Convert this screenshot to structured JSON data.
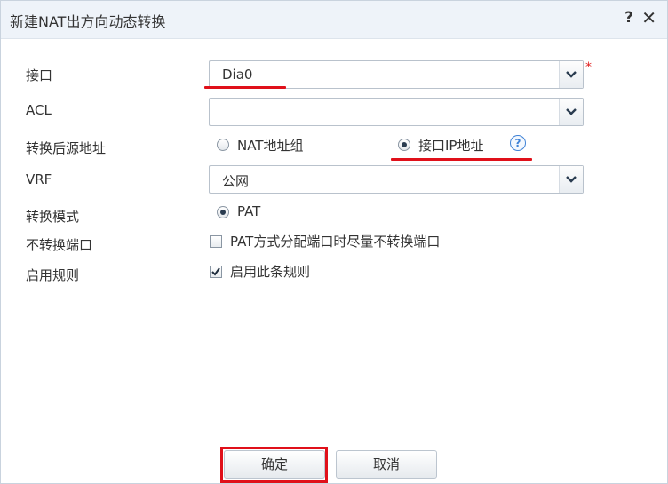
{
  "dialog": {
    "title": "新建NAT出方向动态转换",
    "help_label": "?",
    "close_label": "✕"
  },
  "form": {
    "interface": {
      "label": "接口",
      "value": "Dia0",
      "required_mark": "*"
    },
    "acl": {
      "label": "ACL",
      "value": ""
    },
    "source_addr": {
      "label": "转换后源地址",
      "options": [
        "NAT地址组",
        "接口IP地址"
      ],
      "selected": "接口IP地址",
      "help": "?"
    },
    "vrf": {
      "label": "VRF",
      "value": "公网"
    },
    "mode": {
      "label": "转换模式",
      "option": "PAT",
      "selected": true
    },
    "no_port": {
      "label": "不转换端口",
      "option": "PAT方式分配端口时尽量不转换端口",
      "checked": false
    },
    "enable": {
      "label": "启用规则",
      "option": "启用此条规则",
      "checked": true
    }
  },
  "buttons": {
    "ok": "确定",
    "cancel": "取消"
  },
  "colors": {
    "annotation_red": "#e0101a",
    "titlebar_bg": "#eef3f9",
    "help_blue": "#3f82d6"
  },
  "icons": [
    "chevron-down-icon",
    "help-icon",
    "close-icon",
    "checkmark-icon"
  ]
}
